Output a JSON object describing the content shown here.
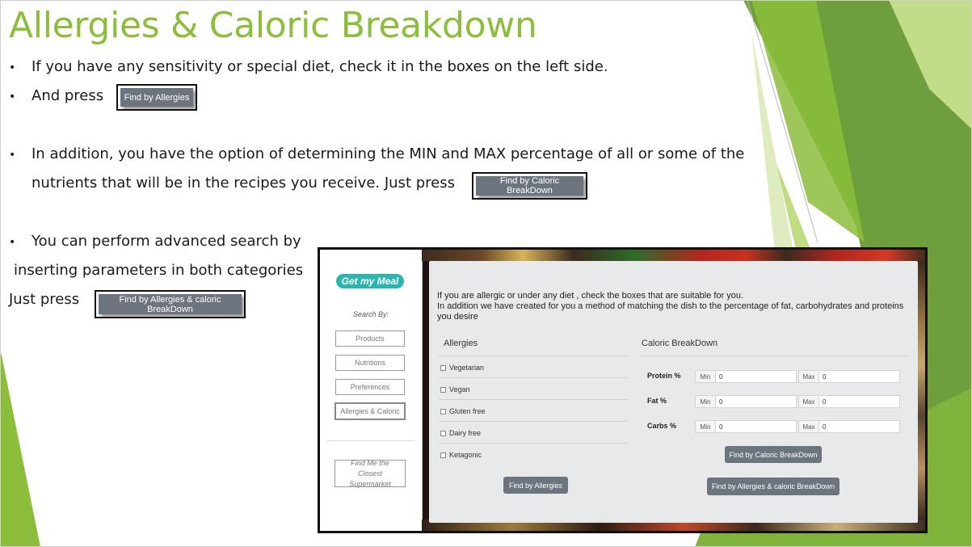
{
  "slide": {
    "title": "Allergies & Caloric Breakdown",
    "bullet_glyph": "•",
    "line1": "If you have any sensitivity or special diet, check it in the boxes on the left side.",
    "line2": "And press",
    "line3a": "In addition, you have the option of determining the MIN and MAX percentage of all or some of  the",
    "line3b": "nutrients that will be in the recipes you receive. Just press",
    "line4a": "You can perform advanced search by",
    "line4b": "inserting parameters in both categories",
    "line4c": "Just press",
    "btn_allergies": "Find by Allergies",
    "btn_caloric": "Find by Caloric BreakDown",
    "btn_both": "Find by Allergies & caloric BreakDown"
  },
  "colors": {
    "title_green": "#8cbd3b",
    "button_gray": "#6c757d",
    "logo_teal": "#2bb5b0"
  },
  "app": {
    "logo": "Get my Meal",
    "search_by": "Search By:",
    "sidebar": [
      "Products",
      "Nutritions",
      "Preferences",
      "Allergies & Caloric"
    ],
    "closest_line1": "Find Me the Closest",
    "closest_line2": "Supermarket",
    "intro_line1": "If you are allergic or under any diet , check the boxes that are suitable for you.",
    "intro_line2": "In addition we have created for you a method of matching the dish to the percentage of fat, carbohydrates and proteins you desire",
    "allergies_title": "Allergies",
    "allergies": [
      "Vegetarian",
      "Vegan",
      "Gluten free",
      "Dairy free",
      "Ketagonic"
    ],
    "caloric_title": "Caloric BreakDown",
    "nutrients": [
      {
        "label": "Protein %",
        "min_label": "Min",
        "min": "0",
        "max_label": "Max",
        "max": "0"
      },
      {
        "label": "Fat %",
        "min_label": "Min",
        "min": "0",
        "max_label": "Max",
        "max": "0"
      },
      {
        "label": "Carbs %",
        "min_label": "Min",
        "min": "0",
        "max_label": "Max",
        "max": "0"
      }
    ],
    "btn_allergies": "Find by Allergies",
    "btn_caloric": "Find by Caloric BreakDown",
    "btn_both": "Find by Allergies & caloric BreakDown"
  }
}
